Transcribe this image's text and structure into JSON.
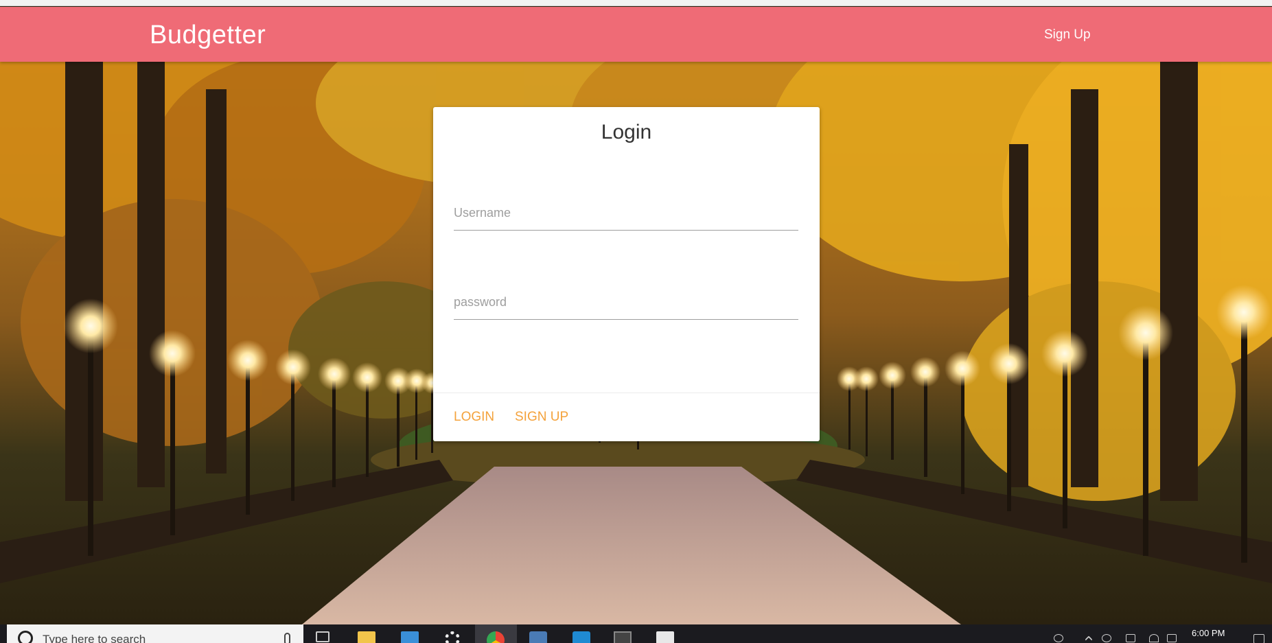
{
  "app": {
    "brand": "Budgetter",
    "nav_link": "Sign Up"
  },
  "login_card": {
    "title": "Login",
    "username_placeholder": "Username",
    "password_placeholder": "password",
    "login_label": "LOGIN",
    "signup_label": "SIGN UP"
  },
  "taskbar": {
    "search_placeholder": "Type here to search",
    "time": "6:00 PM",
    "icons": [
      "search-icon",
      "microphone-icon",
      "task-view-icon",
      "file-explorer-icon",
      "store-icon",
      "settings-icon",
      "chrome-icon",
      "mysql-icon",
      "vscode-icon",
      "terminal-icon",
      "calculator-icon"
    ]
  },
  "colors": {
    "navbar": "#ef6b76",
    "accent": "#f4a23b",
    "card": "#ffffff",
    "taskbar": "#1b1b1f"
  }
}
